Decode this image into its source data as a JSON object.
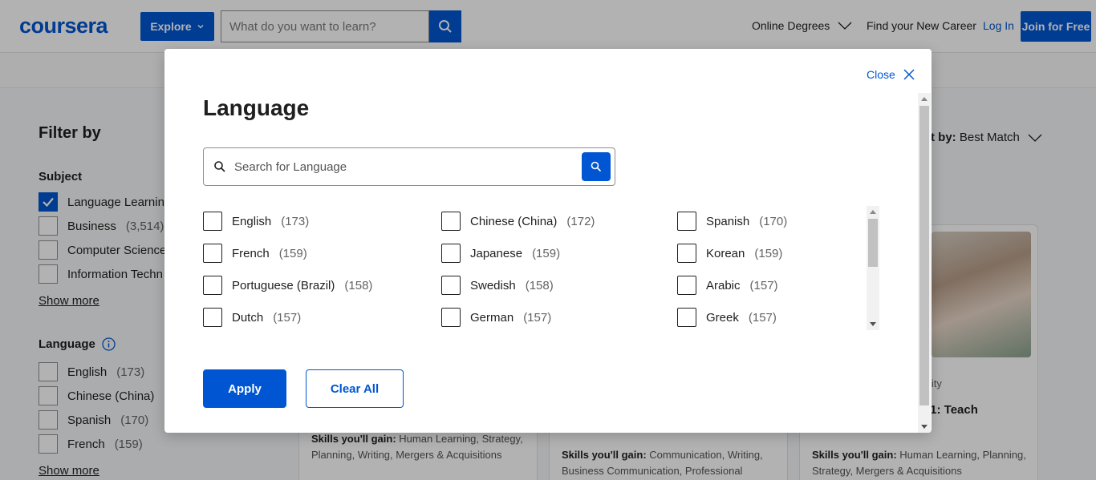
{
  "header": {
    "logo": "coursera",
    "explore_label": "Explore",
    "search_placeholder": "What do you want to learn?",
    "nav": {
      "online_degrees": "Online Degrees",
      "find_career": "Find your New Career",
      "login": "Log In",
      "join": "Join for Free"
    }
  },
  "sidebar": {
    "filter_title": "Filter by",
    "subject": {
      "title": "Subject",
      "items": [
        {
          "label": "Language Learning",
          "count": "",
          "checked": true
        },
        {
          "label": "Business",
          "count": "(3,514)",
          "checked": false
        },
        {
          "label": "Computer Science",
          "count": "",
          "checked": false
        },
        {
          "label": "Information Techn",
          "count": "",
          "checked": false
        }
      ],
      "show_more": "Show more"
    },
    "language": {
      "title": "Language",
      "items": [
        {
          "label": "English",
          "count": "(173)"
        },
        {
          "label": "Chinese (China)",
          "count": "(1"
        },
        {
          "label": "Spanish",
          "count": "(170)"
        },
        {
          "label": "French",
          "count": "(159)"
        }
      ],
      "show_more": "Show more"
    }
  },
  "results": {
    "sort_label": "t by:",
    "sort_value": "Best Match",
    "cards": [
      {
        "skills_label": "Skills you'll gain:",
        "skills": "Human Learning, Strategy, Planning, Writing, Mergers & Acquisitions"
      },
      {
        "skills_label": "Skills you'll gain:",
        "skills": "Communication, Writing, Business Communication, Professional"
      },
      {
        "partner": "rsity",
        "title": "t 1: Teach",
        "skills_label": "Skills you'll gain:",
        "skills": "Human Learning, Planning, Strategy, Mergers & Acquisitions"
      }
    ]
  },
  "modal": {
    "close_label": "Close",
    "title": "Language",
    "search_placeholder": "Search for Language",
    "options": [
      [
        {
          "label": "English",
          "count": "(173)"
        },
        {
          "label": "French",
          "count": "(159)"
        },
        {
          "label": "Portuguese (Brazil)",
          "count": "(158)"
        },
        {
          "label": "Dutch",
          "count": "(157)"
        }
      ],
      [
        {
          "label": "Chinese (China)",
          "count": "(172)"
        },
        {
          "label": "Japanese",
          "count": "(159)"
        },
        {
          "label": "Swedish",
          "count": "(158)"
        },
        {
          "label": "German",
          "count": "(157)"
        }
      ],
      [
        {
          "label": "Spanish",
          "count": "(170)"
        },
        {
          "label": "Korean",
          "count": "(159)"
        },
        {
          "label": "Arabic",
          "count": "(157)"
        },
        {
          "label": "Greek",
          "count": "(157)"
        }
      ]
    ],
    "apply_label": "Apply",
    "clear_label": "Clear All"
  },
  "colors": {
    "brand": "#0056d2",
    "text": "#1f1f1f",
    "muted": "#636363"
  }
}
